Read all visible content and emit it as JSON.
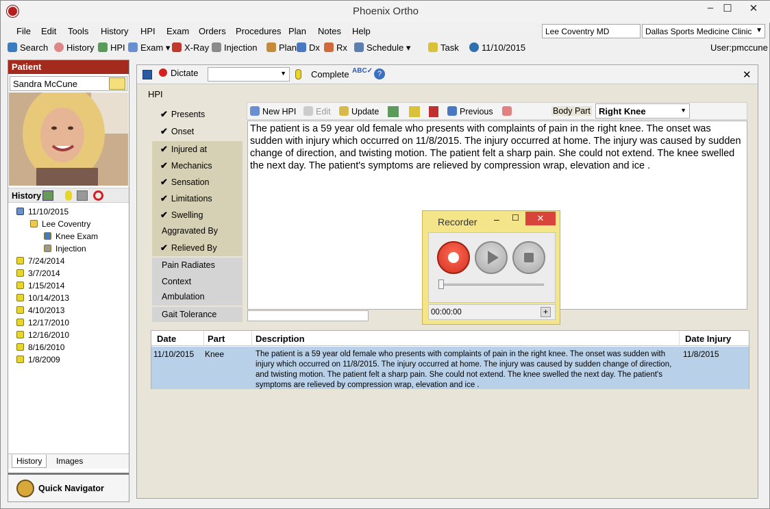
{
  "app": {
    "title": "Phoenix Ortho",
    "window_controls": [
      "–",
      "☐",
      "✕"
    ]
  },
  "menu": [
    "File",
    "Edit",
    "Tools",
    "History",
    "HPI",
    "Exam",
    "Orders",
    "Procedures",
    "Plan",
    "Notes",
    "Help"
  ],
  "toolbar": {
    "items": [
      "Search",
      "History",
      "HPI",
      "Exam",
      "X-Ray",
      "Injection",
      "Plan",
      "Dx",
      "Rx",
      "Schedule",
      "Task"
    ],
    "date": "11/10/2015",
    "user": "User:pmccune",
    "provider": "Lee Coventry MD",
    "clinic": "Dallas Sports Medicine Clinic"
  },
  "patient": {
    "header": "Patient",
    "name": "Sandra McCune"
  },
  "history": {
    "label": "History",
    "tree": [
      {
        "text": "11/10/2015",
        "level": 0,
        "kind": "calendar"
      },
      {
        "text": "Lee Coventry",
        "level": 1,
        "kind": "folder"
      },
      {
        "text": "Knee Exam",
        "level": 2,
        "kind": "exam"
      },
      {
        "text": "Injection",
        "level": 2,
        "kind": "syringe"
      },
      {
        "text": "7/24/2014",
        "level": 0,
        "kind": "lock"
      },
      {
        "text": "3/7/2014",
        "level": 0,
        "kind": "lock"
      },
      {
        "text": "1/15/2014",
        "level": 0,
        "kind": "lock"
      },
      {
        "text": "10/14/2013",
        "level": 0,
        "kind": "lock"
      },
      {
        "text": "4/10/2013",
        "level": 0,
        "kind": "lock"
      },
      {
        "text": "12/17/2010",
        "level": 0,
        "kind": "lock"
      },
      {
        "text": "12/16/2010",
        "level": 0,
        "kind": "lock"
      },
      {
        "text": "8/16/2010",
        "level": 0,
        "kind": "lock"
      },
      {
        "text": "1/8/2009",
        "level": 0,
        "kind": "lock"
      }
    ],
    "tabs": [
      "History",
      "Images"
    ],
    "quick_nav": "Quick Navigator"
  },
  "main_toolbar": {
    "dictate": "Dictate",
    "complete": "Complete",
    "close": "✕"
  },
  "hpi": {
    "label": "HPI",
    "sections": [
      {
        "label": "Presents",
        "checked": true
      },
      {
        "label": "Onset",
        "checked": true
      },
      {
        "label": "Injured at",
        "checked": true
      },
      {
        "label": "Mechanics",
        "checked": true
      },
      {
        "label": "Sensation",
        "checked": true
      },
      {
        "label": "Limitations",
        "checked": true
      },
      {
        "label": "Swelling",
        "checked": true
      },
      {
        "label": "Aggravated By",
        "checked": false
      },
      {
        "label": "Relieved By",
        "checked": true
      },
      {
        "label": "Pain Radiates",
        "checked": false
      },
      {
        "label": "Context",
        "checked": false
      },
      {
        "label": "Ambulation",
        "checked": false
      },
      {
        "label": "Gait Tolerance",
        "checked": false
      }
    ],
    "toolbar": {
      "new_hpi": "New HPI",
      "edit": "Edit",
      "update": "Update",
      "previous": "Previous",
      "body_part_label": "Body Part",
      "body_part_value": "Right Knee"
    },
    "text": "The patient is a 59 year old female who presents with complaints of pain in the right knee. The onset was sudden with injury which occurred on 11/8/2015. The injury occurred at home. The injury was caused by sudden change of direction, and twisting motion.  The patient felt a sharp pain. She could not extend. The knee swelled the next day.  The patient's symptoms are relieved by compression wrap, elevation and ice ."
  },
  "grid": {
    "columns": [
      "Date",
      "Part",
      "Description",
      "Date Injury"
    ],
    "rows": [
      {
        "date": "11/10/2015",
        "part": "Knee",
        "description": "The patient is a 59 year old female who presents with complaints of pain in the right knee. The onset was sudden with injury which occurred on 11/8/2015. The injury occurred at home. The injury was caused by sudden change of direction, and twisting motion.  The patient felt a sharp pain. She could not extend. The knee swelled the next day.  The patient's symptoms are relieved by compression wrap, elevation and ice .",
        "date_injury": "11/8/2015"
      }
    ]
  },
  "recorder": {
    "title": "Recorder",
    "time": "00:00:00"
  },
  "colors": {
    "patient_header": "#a52a1e",
    "hpi_checked_bg": "#d6d0b4",
    "selected_row": "#b8d0e8",
    "recorder_bg": "#f4e58a",
    "record_red": "#e03a2a"
  }
}
